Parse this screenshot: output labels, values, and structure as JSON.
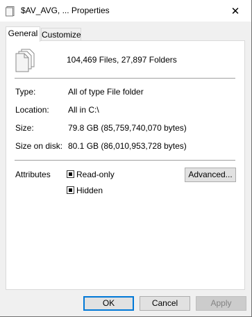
{
  "window": {
    "title": "$AV_AVG, ... Properties",
    "close_glyph": "✕"
  },
  "tabs": [
    {
      "label": "General",
      "active": true
    },
    {
      "label": "Customize",
      "active": false
    }
  ],
  "summary": {
    "icon": "multiple-files-icon",
    "text": "104,469 Files, 27,897 Folders"
  },
  "details": {
    "type_label": "Type:",
    "type_value": "All of type File folder",
    "location_label": "Location:",
    "location_value": "All in C:\\",
    "size_label": "Size:",
    "size_value": "79.8 GB (85,759,740,070 bytes)",
    "size_on_disk_label": "Size on disk:",
    "size_on_disk_value": "80.1 GB (86,010,953,728 bytes)"
  },
  "attributes": {
    "label": "Attributes",
    "readonly_label": "Read-only",
    "readonly_state": "indeterminate",
    "hidden_label": "Hidden",
    "hidden_state": "indeterminate",
    "advanced_label": "Advanced..."
  },
  "buttons": {
    "ok": "OK",
    "cancel": "Cancel",
    "apply": "Apply",
    "apply_enabled": false
  },
  "colors": {
    "accent": "#0078d7",
    "panel_bg": "#ffffff",
    "window_bg": "#f0f0f0"
  }
}
